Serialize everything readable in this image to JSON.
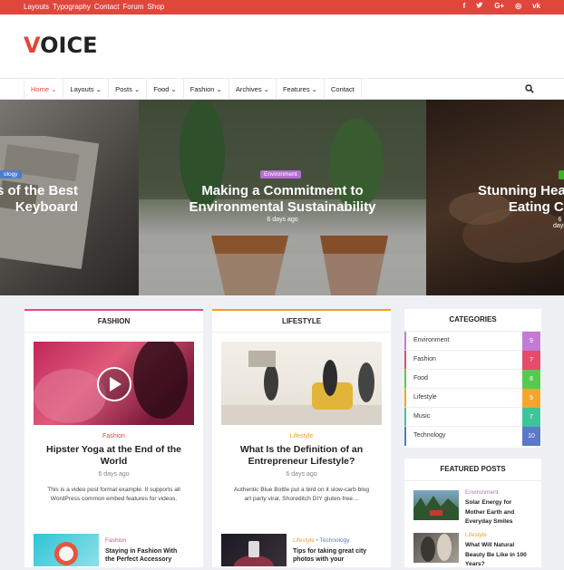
{
  "topbar": {
    "links": [
      "Layouts",
      "Typography",
      "Contact",
      "Forum",
      "Shop"
    ],
    "social": [
      "f",
      "t",
      "G+",
      "◎",
      "vk"
    ]
  },
  "logo": {
    "first": "V",
    "rest": "OICE"
  },
  "nav": {
    "items": [
      "Home",
      "Layouts",
      "Posts",
      "Food",
      "Fashion",
      "Archives",
      "Features",
      "Contact"
    ]
  },
  "slider": [
    {
      "category": "ology",
      "category_color": "#4a7bd0",
      "title_line1": "s of the Best",
      "title_line2": "Keyboard",
      "date": ""
    },
    {
      "category": "Environment",
      "category_color": "#b56fd1",
      "title_line1": "Making a Commitment to",
      "title_line2": "Environmental Sustainability",
      "date": "6 days ago"
    },
    {
      "category": "",
      "category_color": "#43b02a",
      "title_line1": "Stunning Hea",
      "title_line2": "Eating C",
      "date": "6 days"
    }
  ],
  "fashion": {
    "heading": "FASHION",
    "accent": "#e84a7f",
    "main": {
      "category": "Fashion",
      "title": "Hipster Yoga at the End of the World",
      "date": "6 days ago",
      "excerpt": "This is a video post format example. It supports all WordPress common embed features for videos."
    },
    "small": {
      "category": "Fashion",
      "title": "Staying in Fashion With the Perfect Accessory"
    }
  },
  "lifestyle": {
    "heading": "LIFESTYLE",
    "accent": "#f0a030",
    "main": {
      "category": "Lifestyle",
      "title": "What Is the Definition of an Entrepreneur Lifestyle?",
      "date": "6 days ago",
      "excerpt": "Authentic Blue Bottle put a bird on it slow-carb blog art party viral, Shoreditch DIY gluten-free…"
    },
    "small": {
      "category": "Lifestyle",
      "category2": "Technology",
      "separator": " • ",
      "title": "Tips for taking great city photos with your"
    }
  },
  "categories": {
    "heading": "CATEGORIES",
    "items": [
      {
        "name": "Environment",
        "count": "9",
        "color": "#c27bd6"
      },
      {
        "name": "Fashion",
        "count": "7",
        "color": "#e84a6a"
      },
      {
        "name": "Food",
        "count": "8",
        "color": "#59c84f"
      },
      {
        "name": "Lifestyle",
        "count": "9",
        "color": "#f5a52d"
      },
      {
        "name": "Music",
        "count": "7",
        "color": "#3fc49a"
      },
      {
        "name": "Technology",
        "count": "10",
        "color": "#5c78c9"
      }
    ]
  },
  "featured": {
    "heading": "FEATURED POSTS",
    "items": [
      {
        "category": "Environment",
        "category_color": "#b56fd1",
        "title": "Solar Energy for Mother Earth and Everyday Smiles"
      },
      {
        "category": "Lifestyle",
        "category_color": "#f0a030",
        "title": "What Will Natural Beauty Be Like in 100 Years?"
      }
    ]
  }
}
